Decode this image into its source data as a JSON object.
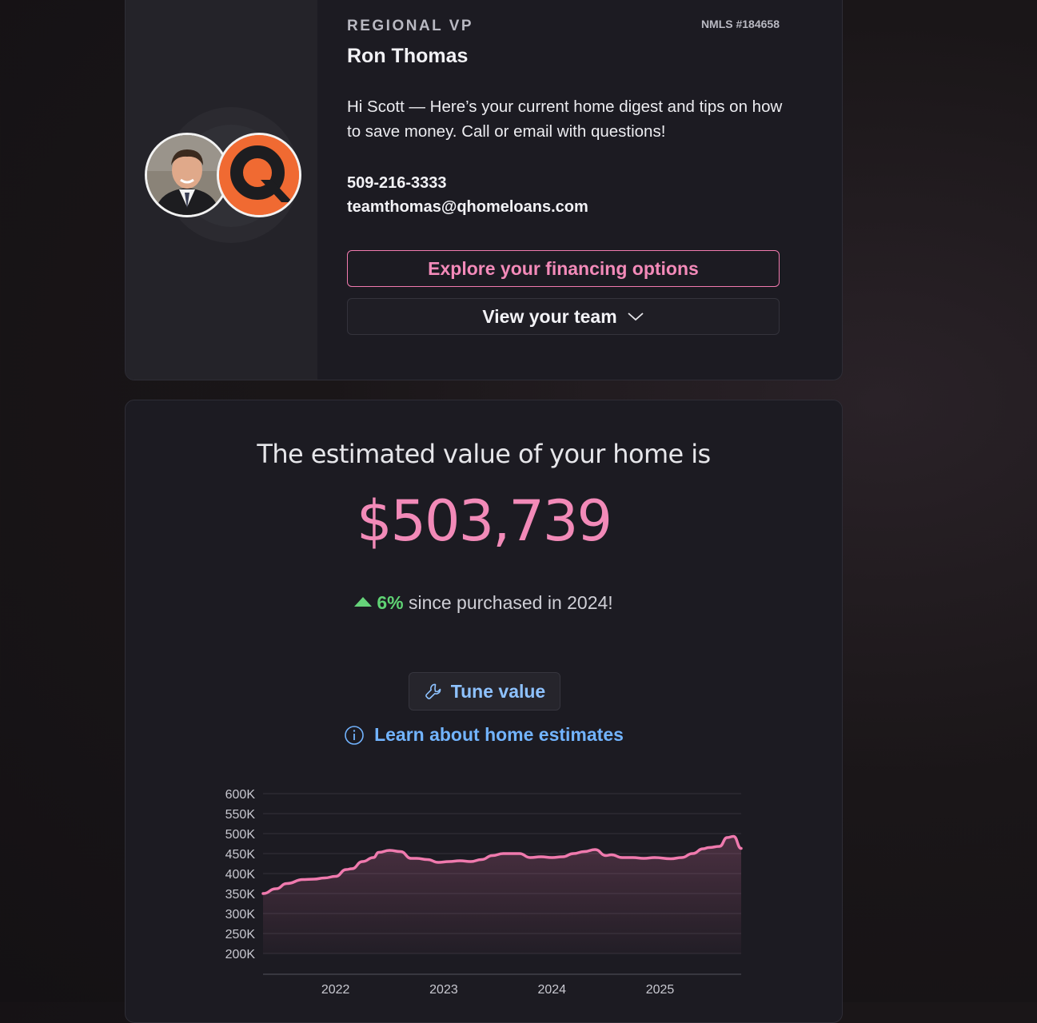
{
  "agent": {
    "role": "REGIONAL VP",
    "nmls": "NMLS #184658",
    "name": "Ron Thomas",
    "greeting": "Hi Scott — Here’s your current home digest and tips on how to save money. Call or email with questions!",
    "phone": "509-216-3333",
    "email": "teamthomas@qhomeloans.com",
    "finance_button": "Explore your financing options",
    "team_button": "View your team",
    "logo_letter": "Q",
    "colors": {
      "accent_pink": "#f38ab9",
      "logo_orange": "#f06a32"
    }
  },
  "estimate": {
    "heading": "The estimated value of your home is",
    "value": "$503,739",
    "change_pct": "6%",
    "change_text": "since purchased in 2024!",
    "tune_button": "Tune value",
    "learn_link": "Learn about home estimates",
    "colors": {
      "value": "#f28ab8",
      "up": "#5fd374",
      "link": "#72b4ff"
    }
  },
  "chart_data": {
    "type": "area",
    "title": "",
    "xlabel": "",
    "ylabel": "",
    "ylim": [
      200000,
      600000
    ],
    "yticks": [
      "600K",
      "550K",
      "500K",
      "450K",
      "400K",
      "350K",
      "300K",
      "250K",
      "200K"
    ],
    "xticks": [
      "2022",
      "2023",
      "2024",
      "2025"
    ],
    "xlim": [
      2021.33,
      2025.75
    ],
    "grid": true,
    "x": [
      2021.33,
      2021.45,
      2021.55,
      2021.7,
      2021.8,
      2021.9,
      2022.0,
      2022.1,
      2022.15,
      2022.25,
      2022.35,
      2022.4,
      2022.5,
      2022.6,
      2022.7,
      2022.75,
      2022.85,
      2022.95,
      2023.05,
      2023.15,
      2023.25,
      2023.35,
      2023.45,
      2023.55,
      2023.7,
      2023.8,
      2023.9,
      2024.0,
      2024.1,
      2024.2,
      2024.3,
      2024.4,
      2024.5,
      2024.55,
      2024.65,
      2024.75,
      2024.85,
      2024.95,
      2025.1,
      2025.2,
      2025.3,
      2025.4,
      2025.45,
      2025.55,
      2025.62,
      2025.68,
      2025.75
    ],
    "values": [
      350000,
      362000,
      375000,
      385000,
      386000,
      389000,
      393000,
      410000,
      412000,
      430000,
      440000,
      453000,
      458000,
      455000,
      438000,
      438000,
      435000,
      428000,
      430000,
      432000,
      430000,
      435000,
      445000,
      450000,
      450000,
      440000,
      442000,
      440000,
      442000,
      450000,
      455000,
      460000,
      445000,
      447000,
      440000,
      440000,
      438000,
      440000,
      437000,
      440000,
      450000,
      462000,
      465000,
      468000,
      490000,
      493000,
      463000
    ],
    "line_color": "#f07aae"
  }
}
